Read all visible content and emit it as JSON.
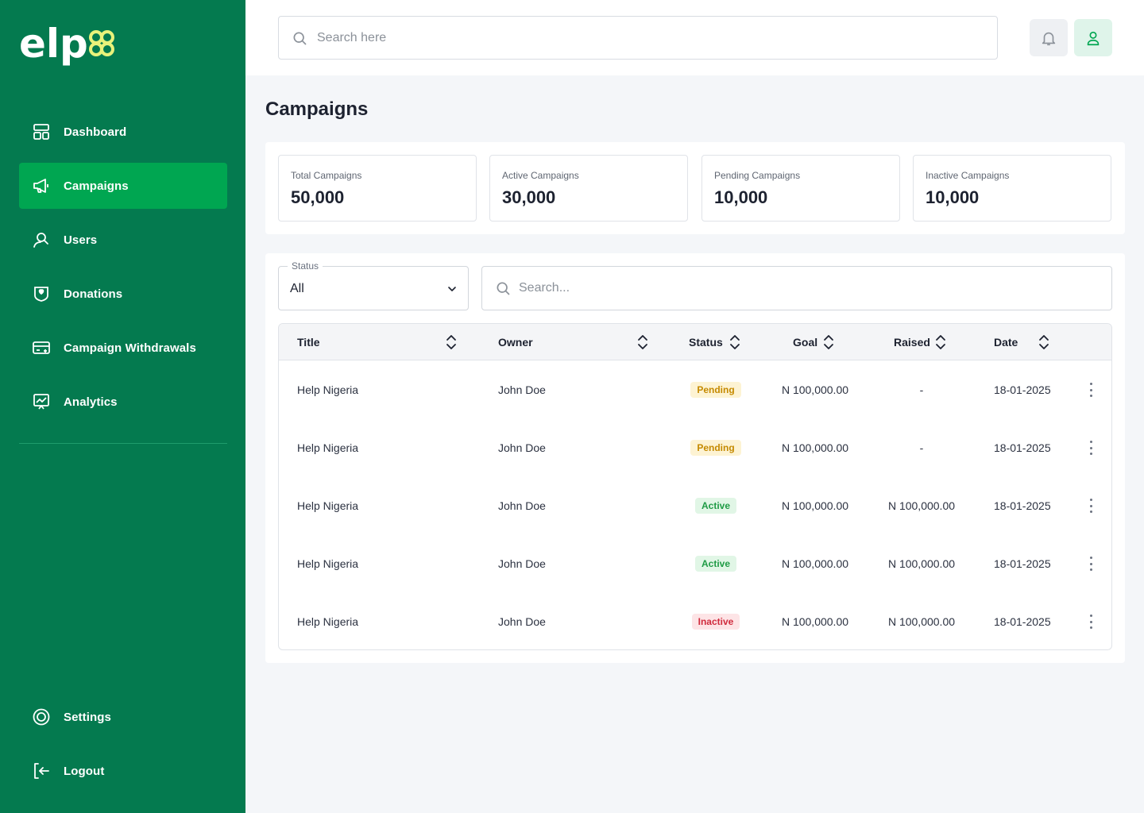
{
  "brand": {
    "logo_text": "elp"
  },
  "sidebar": {
    "items": [
      {
        "label": "Dashboard",
        "icon": "dashboard-icon"
      },
      {
        "label": "Campaigns",
        "icon": "megaphone-icon",
        "active": true
      },
      {
        "label": "Users",
        "icon": "users-icon"
      },
      {
        "label": "Donations",
        "icon": "donation-icon"
      },
      {
        "label": "Campaign Withdrawals",
        "icon": "wallet-icon"
      },
      {
        "label": "Analytics",
        "icon": "analytics-icon"
      }
    ],
    "bottom_items": [
      {
        "label": "Settings",
        "icon": "gear-icon"
      },
      {
        "label": "Logout",
        "icon": "logout-icon"
      }
    ]
  },
  "topbar": {
    "search_placeholder": "Search here"
  },
  "page": {
    "title": "Campaigns"
  },
  "stats": [
    {
      "label": "Total Campaigns",
      "value": "50,000"
    },
    {
      "label": "Active Campaigns",
      "value": "30,000"
    },
    {
      "label": "Pending Campaigns",
      "value": "10,000"
    },
    {
      "label": "Inactive Campaigns",
      "value": "10,000"
    }
  ],
  "filters": {
    "status_legend": "Status",
    "status_value": "All",
    "search_placeholder": "Search..."
  },
  "table": {
    "columns": [
      "Title",
      "Owner",
      "Status",
      "Goal",
      "Raised",
      "Date"
    ],
    "rows": [
      {
        "title": "Help Nigeria",
        "owner": "John Doe",
        "status": "Pending",
        "goal": "N 100,000.00",
        "raised": "-",
        "date": "18-01-2025"
      },
      {
        "title": "Help Nigeria",
        "owner": "John Doe",
        "status": "Pending",
        "goal": "N 100,000.00",
        "raised": "-",
        "date": "18-01-2025"
      },
      {
        "title": "Help Nigeria",
        "owner": "John Doe",
        "status": "Active",
        "goal": "N 100,000.00",
        "raised": "N 100,000.00",
        "date": "18-01-2025"
      },
      {
        "title": "Help Nigeria",
        "owner": "John Doe",
        "status": "Active",
        "goal": "N 100,000.00",
        "raised": "N 100,000.00",
        "date": "18-01-2025"
      },
      {
        "title": "Help Nigeria",
        "owner": "John Doe",
        "status": "Inactive",
        "goal": "N 100,000.00",
        "raised": "N 100,000.00",
        "date": "18-01-2025"
      }
    ]
  },
  "colors": {
    "sidebar_bg": "#047a4f",
    "active_nav": "#00a651",
    "logo_accent": "#e9f27a",
    "pending": "#c58a00",
    "active": "#1f9b45",
    "inactive": "#d02b3d"
  }
}
